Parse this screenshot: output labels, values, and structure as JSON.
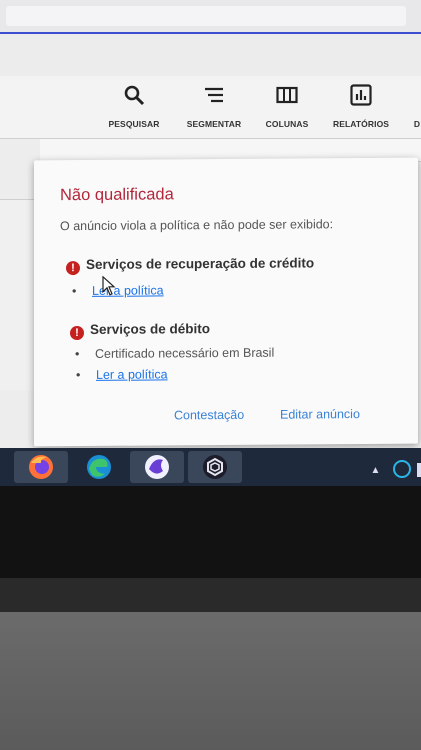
{
  "toolbar": {
    "items": [
      {
        "label": "PESQUISAR",
        "icon": "search-icon"
      },
      {
        "label": "SEGMENTAR",
        "icon": "segment-icon"
      },
      {
        "label": "COLUNAS",
        "icon": "columns-icon"
      },
      {
        "label": "RELATÓRIOS",
        "icon": "reports-icon"
      },
      {
        "label": "D"
      }
    ]
  },
  "dialog": {
    "title": "Não qualificada",
    "description": "O anúncio viola a política e não pode ser exibido:",
    "reasons": [
      {
        "title": "Serviços de recuperação de crédito",
        "bullets": [
          "Ler a política"
        ]
      },
      {
        "title": "Serviços de débito",
        "bullets": [
          "Certificado necessário em Brasil",
          "Ler a política"
        ]
      }
    ],
    "actions": {
      "appeal": "Contestação",
      "edit": "Editar anúncio"
    }
  },
  "colors": {
    "title": "#b2263a",
    "link": "#1a73e8",
    "error": "#c5221f",
    "taskbar": "#1e2a3c"
  },
  "taskbar": {
    "apps": [
      "firefox-icon",
      "edge-icon",
      "app-icon",
      "vpn-icon"
    ]
  }
}
